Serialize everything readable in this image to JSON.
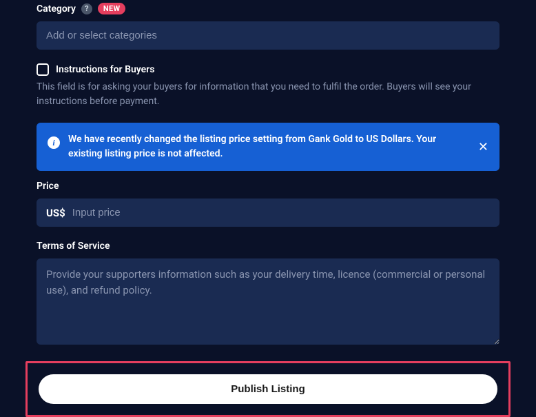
{
  "category": {
    "label": "Category",
    "badge": "NEW",
    "placeholder": "Add or select categories"
  },
  "instructions": {
    "label": "Instructions for Buyers",
    "helper": "This field is for asking your buyers for information that you need to fulfil the order. Buyers will see your instructions before payment."
  },
  "banner": {
    "text": "We have recently changed the listing price setting from Gank Gold to US Dollars. Your existing listing price is not affected."
  },
  "price": {
    "label": "Price",
    "currency": "US$",
    "placeholder": "Input price"
  },
  "tos": {
    "label": "Terms of Service",
    "placeholder": "Provide your supporters information such as your delivery time, licence (commercial or personal use), and refund policy."
  },
  "publish": {
    "label": "Publish Listing"
  }
}
